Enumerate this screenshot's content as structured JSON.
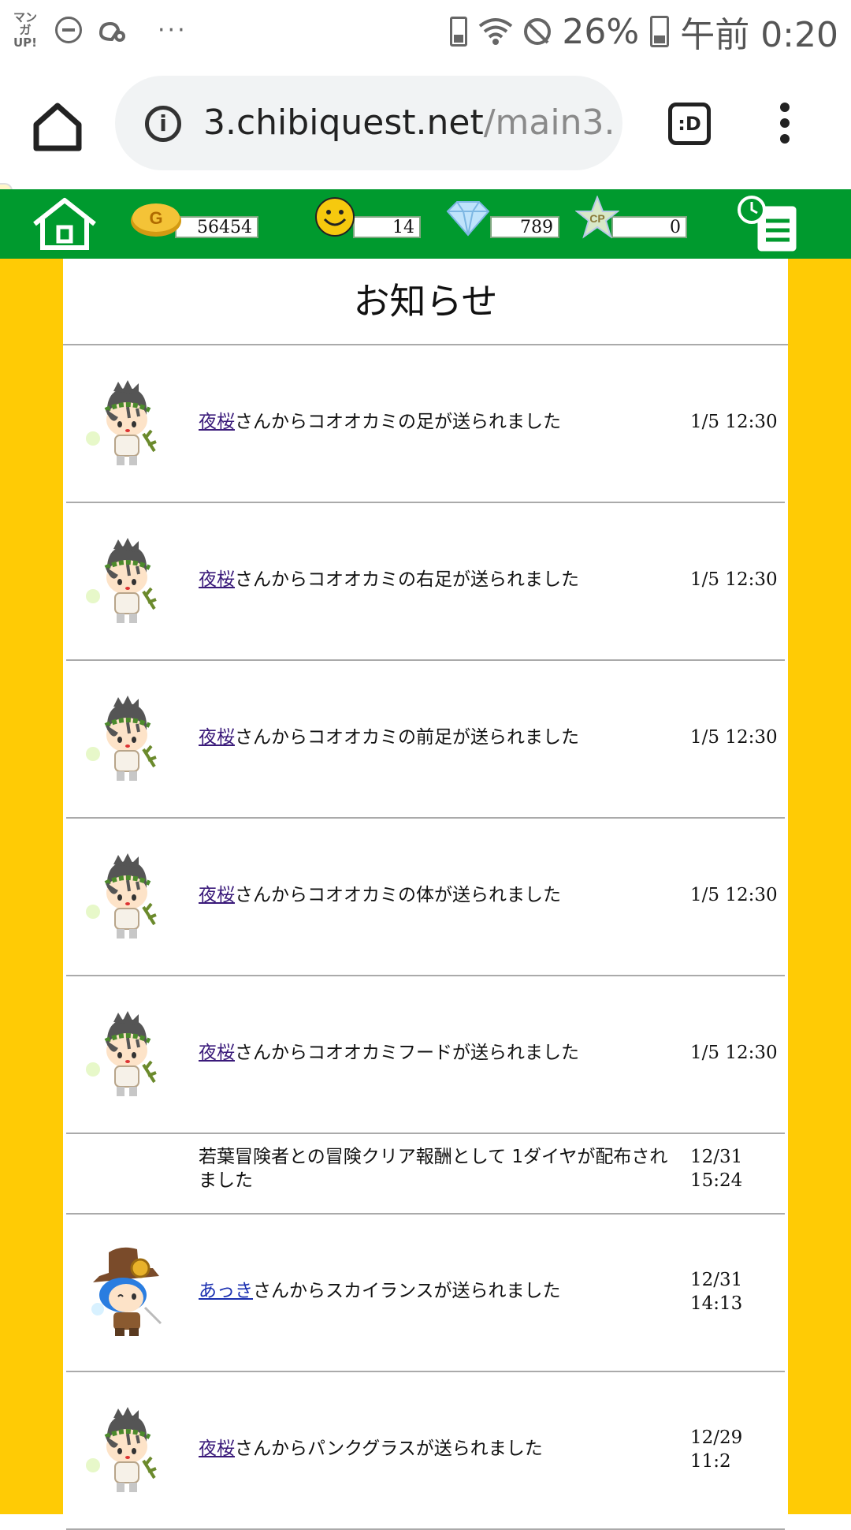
{
  "status_bar": {
    "app_badge": "マンガ UP!",
    "more_dots": "···",
    "battery_percent": "26%",
    "clock": "午前 0:20"
  },
  "browser": {
    "url_host": "3.chibiquest.net",
    "url_path": "/main3.",
    "tabs_label": ":D"
  },
  "game_header": {
    "gold": "56454",
    "smile": "14",
    "diamond": "789",
    "cp": "0",
    "gold_icon_letter": "G",
    "cp_icon_label": "CP"
  },
  "page": {
    "title": "お知らせ"
  },
  "notices": [
    {
      "sender": "夜桜",
      "text": "さんからコオオカミの足が送られました",
      "time_line1": "1/5 12:30",
      "time_line2": "",
      "avatar": "green-hair-avatar"
    },
    {
      "sender": "夜桜",
      "text": "さんからコオオカミの右足が送られました",
      "time_line1": "1/5 12:30",
      "time_line2": "",
      "avatar": "green-hair-avatar"
    },
    {
      "sender": "夜桜",
      "text": "さんからコオオカミの前足が送られました",
      "time_line1": "1/5 12:30",
      "time_line2": "",
      "avatar": "green-hair-avatar"
    },
    {
      "sender": "夜桜",
      "text": "さんからコオオカミの体が送られました",
      "time_line1": "1/5 12:30",
      "time_line2": "",
      "avatar": "green-hair-avatar"
    },
    {
      "sender": "夜桜",
      "text": "さんからコオオカミフードが送られました",
      "time_line1": "1/5 12:30",
      "time_line2": "",
      "avatar": "green-hair-avatar"
    },
    {
      "sender": "",
      "text": "若葉冒険者との冒険クリア報酬として 1ダイヤが配布されました",
      "time_line1": "12/31",
      "time_line2": "15:24",
      "avatar": ""
    },
    {
      "sender": "あっき",
      "text": "さんからスカイランスが送られました",
      "time_line1": "12/31",
      "time_line2": "14:13",
      "avatar": "blue-hair-hat-avatar"
    },
    {
      "sender": "夜桜",
      "text": "さんからパンクグラスが送られました",
      "time_line1": "12/29",
      "time_line2": "11:2",
      "avatar": "green-hair-avatar"
    }
  ]
}
